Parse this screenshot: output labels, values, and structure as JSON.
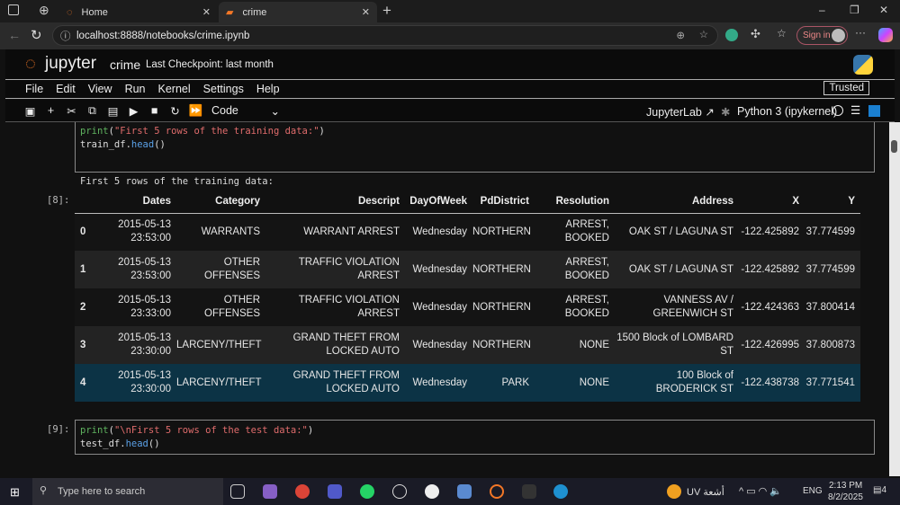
{
  "browser": {
    "tabs": [
      {
        "label": "Home"
      },
      {
        "label": "crime"
      }
    ],
    "url": "localhost:8888/notebooks/crime.ipynb",
    "sign_in": "Sign in"
  },
  "jupyter": {
    "logo_text": "jupyter",
    "notebook_name": "crime",
    "checkpoint": "Last Checkpoint: last month",
    "trusted": "Trusted",
    "menu": [
      "File",
      "Edit",
      "View",
      "Run",
      "Kernel",
      "Settings",
      "Help"
    ],
    "cell_type": "Code",
    "jupyterlab_link": "JupyterLab",
    "kernel": "Python 3 (ipykernel)"
  },
  "cells": [
    {
      "code_line1_fn": "print",
      "code_line1_str": "\"First 5 rows of the training data:\"",
      "code_line2_obj": "train_df.",
      "code_line2_method": "head",
      "stdout": "First 5 rows of the training data:",
      "out_prompt": "[8]:"
    },
    {
      "prompt": "[9]:",
      "code_line1_fn": "print",
      "code_line1_str": "\"\\nFirst 5 rows of the test data:\"",
      "code_line2_obj": "test_df.",
      "code_line2_method": "head"
    }
  ],
  "table": {
    "columns": [
      "",
      "Dates",
      "Category",
      "Descript",
      "DayOfWeek",
      "PdDistrict",
      "Resolution",
      "Address",
      "X",
      "Y"
    ],
    "rows": [
      [
        "0",
        "2015-05-13 23:53:00",
        "WARRANTS",
        "WARRANT ARREST",
        "Wednesday",
        "NORTHERN",
        "ARREST, BOOKED",
        "OAK ST / LAGUNA ST",
        "-122.425892",
        "37.774599"
      ],
      [
        "1",
        "2015-05-13 23:53:00",
        "OTHER OFFENSES",
        "TRAFFIC VIOLATION ARREST",
        "Wednesday",
        "NORTHERN",
        "ARREST, BOOKED",
        "OAK ST / LAGUNA ST",
        "-122.425892",
        "37.774599"
      ],
      [
        "2",
        "2015-05-13 23:33:00",
        "OTHER OFFENSES",
        "TRAFFIC VIOLATION ARREST",
        "Wednesday",
        "NORTHERN",
        "ARREST, BOOKED",
        "VANNESS AV / GREENWICH ST",
        "-122.424363",
        "37.800414"
      ],
      [
        "3",
        "2015-05-13 23:30:00",
        "LARCENY/THEFT",
        "GRAND THEFT FROM LOCKED AUTO",
        "Wednesday",
        "NORTHERN",
        "NONE",
        "1500 Block of LOMBARD ST",
        "-122.426995",
        "37.800873"
      ],
      [
        "4",
        "2015-05-13 23:30:00",
        "LARCENY/THEFT",
        "GRAND THEFT FROM LOCKED AUTO",
        "Wednesday",
        "PARK",
        "NONE",
        "100 Block of BRODERICK ST",
        "-122.438738",
        "37.771541"
      ]
    ]
  },
  "taskbar": {
    "search_placeholder": "Type here to search",
    "weather": "UV أشعة",
    "lang": "ENG",
    "time": "2:13 PM",
    "date": "8/2/2025",
    "notifications": "4"
  }
}
